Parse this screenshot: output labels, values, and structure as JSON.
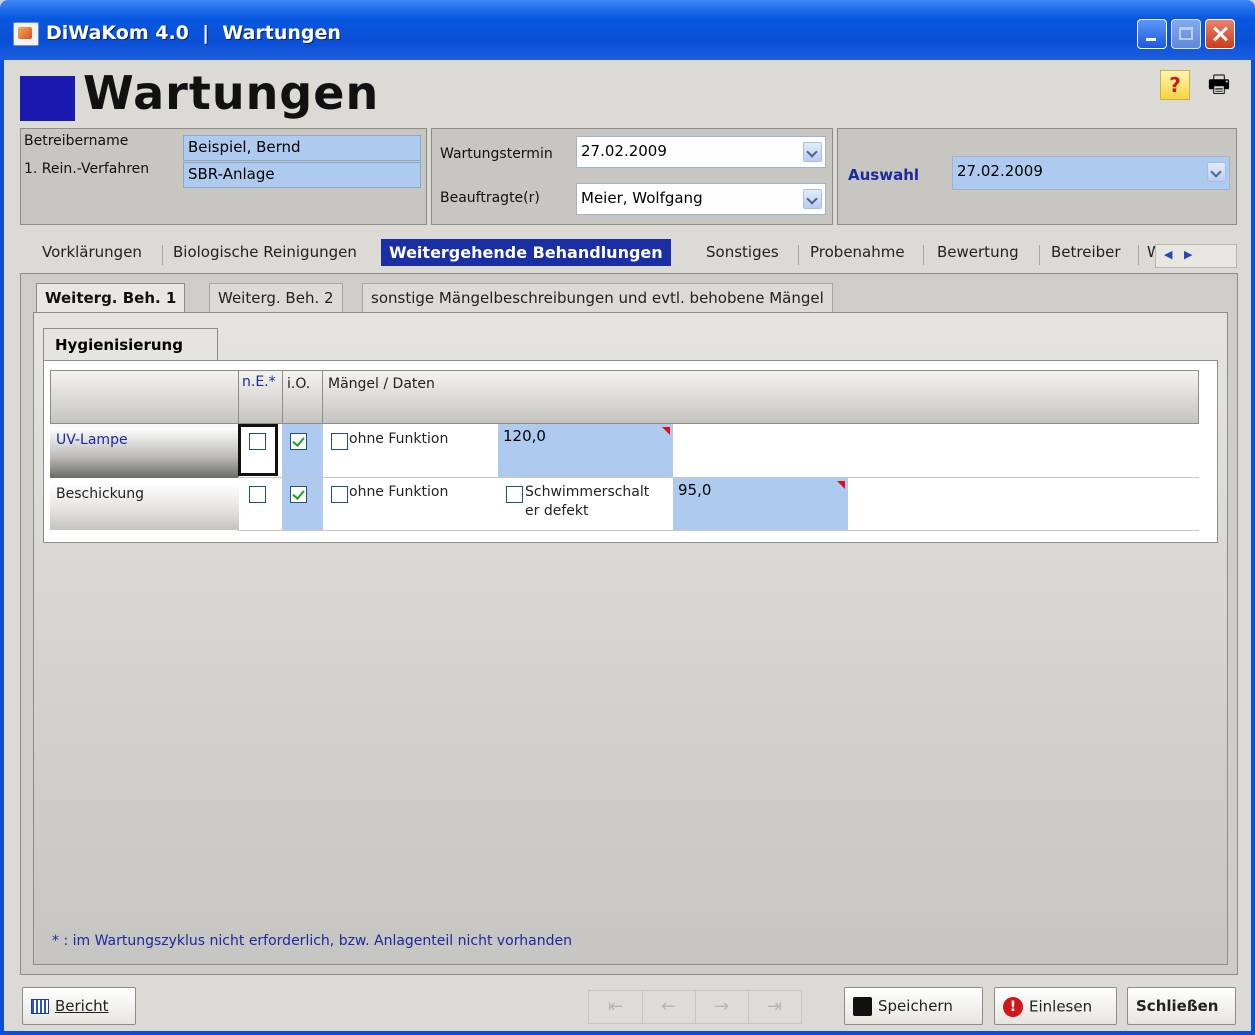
{
  "window": {
    "title": "DiWaKom 4.0  |  Wartungen"
  },
  "page": {
    "title": "Wartungen"
  },
  "header": {
    "operator_label": "Betreibername",
    "operator_value": "Beispiel, Bernd",
    "process_label": "1. Rein.-Verfahren",
    "process_value": "SBR-Anlage",
    "date_label": "Wartungstermin",
    "date_value": "27.02.2009",
    "assignee_label": "Beauftragte(r)",
    "assignee_value": "Meier, Wolfgang",
    "selection_label": "Auswahl",
    "selection_value": "27.02.2009"
  },
  "tabs": [
    {
      "label": "Vorklärungen"
    },
    {
      "label": "Biologische Reinigungen"
    },
    {
      "label": "Weitergehende Behandlungen"
    },
    {
      "label": "Sonstiges"
    },
    {
      "label": "Probenahme"
    },
    {
      "label": "Bewertung"
    },
    {
      "label": "Betreiber"
    },
    {
      "label": "Wa"
    }
  ],
  "subtabs": [
    {
      "label": "Weiterg. Beh. 1"
    },
    {
      "label": "Weiterg. Beh. 2"
    },
    {
      "label": "sonstige Mängelbeschreibungen und evtl. behobene Mängel"
    }
  ],
  "section": {
    "title": "Hygienisierung"
  },
  "grid": {
    "columns": {
      "ne": "n.E.*",
      "io": "i.O.",
      "defects": "Mängel / Daten"
    },
    "rows": [
      {
        "label": "UV-Lampe",
        "ne_checked": false,
        "io_checked": true,
        "no_function_label": "ohne Funktion",
        "no_function_checked": false,
        "value": "120,0"
      },
      {
        "label": "Beschickung",
        "ne_checked": false,
        "io_checked": true,
        "no_function_label": "ohne Funktion",
        "no_function_checked": false,
        "float_switch_label_1": "Schwimmerschalt",
        "float_switch_label_2": "er defekt",
        "float_switch_checked": false,
        "value": "95,0"
      }
    ]
  },
  "footnote": "* : im Wartungszyklus nicht erforderlich, bzw. Anlagenteil nicht vorhanden",
  "buttons": {
    "report": "Bericht",
    "save": "Speichern",
    "load": "Einlesen",
    "close": "Schließen"
  },
  "icons": {
    "help": "help-icon",
    "print": "printer-icon",
    "report": "report-icon",
    "save": "floppy-disk-icon",
    "load": "alert-icon"
  }
}
